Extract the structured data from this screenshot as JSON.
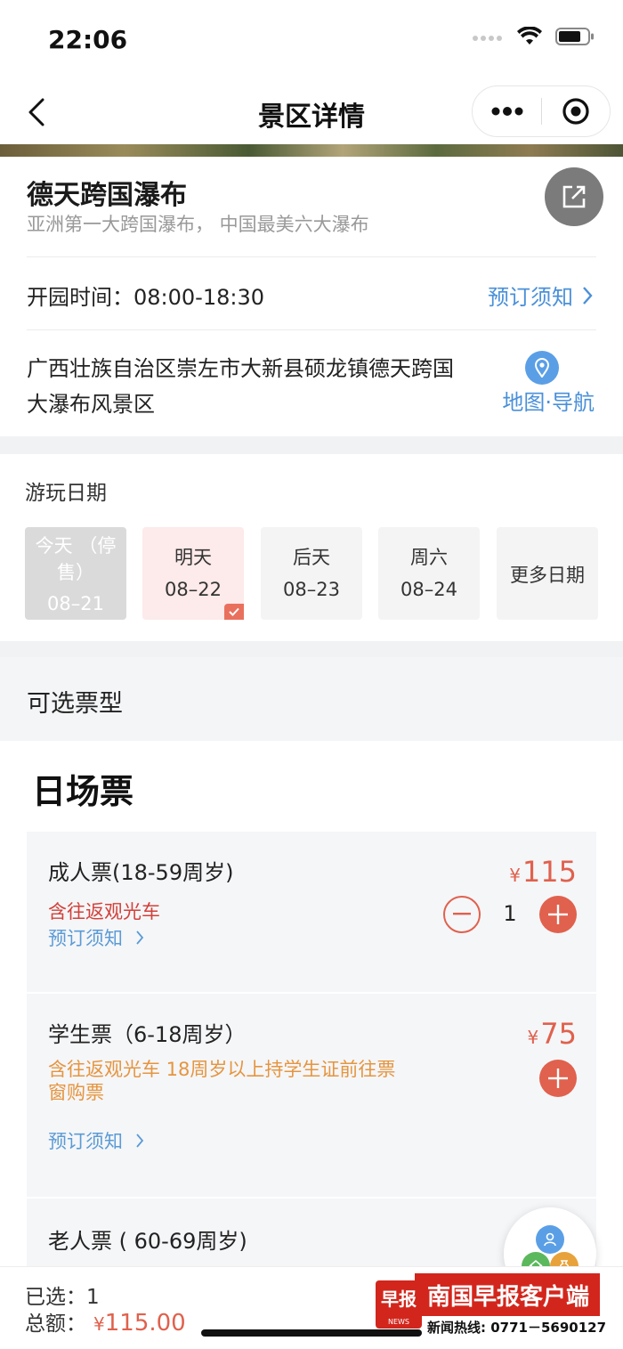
{
  "status_bar": {
    "time": "22:06"
  },
  "nav": {
    "title": "景区详情"
  },
  "spot": {
    "name": "德天跨国瀑布",
    "subtitle": "亚洲第一大跨国瀑布， 中国最美六大瀑布",
    "hours": "开园时间：08:00-18:30",
    "notice_link": "预订须知",
    "address": "广西壮族自治区崇左市大新县硕龙镇德天跨国大瀑布风景区",
    "map_link": "地图·导航"
  },
  "dates": {
    "title": "游玩日期",
    "items": [
      {
        "line1": "今天 （停售）",
        "line2": "08–21",
        "state": "disabled"
      },
      {
        "line1": "明天",
        "line2": "08–22",
        "state": "selected"
      },
      {
        "line1": "后天",
        "line2": "08–23",
        "state": "normal"
      },
      {
        "line1": "周六",
        "line2": "08–24",
        "state": "normal"
      },
      {
        "line1": "更多日期",
        "line2": "",
        "state": "more"
      }
    ]
  },
  "ticket_types_label": "可选票型",
  "day_ticket_title": "日场票",
  "tickets": [
    {
      "name": "成人票(18-59周岁)",
      "desc": "含往返观光车",
      "notice": "预订须知",
      "currency": "¥",
      "price": "115",
      "quantity": "1"
    },
    {
      "name": "学生票（6-18周岁）",
      "desc": "含往返观光车 18周岁以上持学生证前往票窗购票",
      "notice": "预订须知",
      "currency": "¥",
      "price": "75"
    },
    {
      "name": "老人票 ( 60-69周岁)"
    }
  ],
  "summary": {
    "selected_label": "已选：",
    "selected_count": "1",
    "total_label": "总额：",
    "currency": "¥",
    "total_amount": "115.00"
  },
  "watermark": {
    "logo_text": "早报",
    "logo_sub": "NEWS",
    "brand": "南国早报客户端",
    "hotline": "新闻热线: 0771－5690127"
  },
  "colors": {
    "accent": "#e0614d",
    "link": "#4a90d9",
    "notice_orange": "#e5953f"
  }
}
